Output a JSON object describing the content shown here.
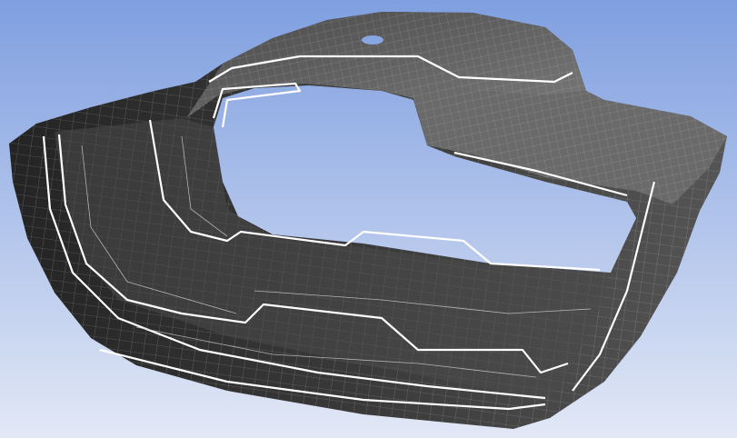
{
  "viewport": {
    "background_top": "#7f9fe0",
    "background_bottom": "#e2e8f6",
    "mesh_dark": "#2e2e2e",
    "mesh_mid": "#5a5a5a",
    "mesh_light": "#8a8a8a",
    "mesh_line": "#b8b8b8",
    "edge_line": "#ffffff"
  }
}
